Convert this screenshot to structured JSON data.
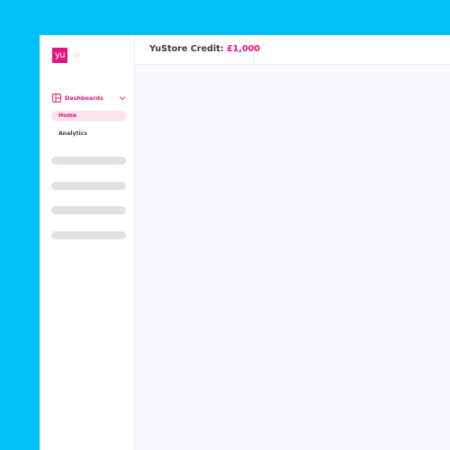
{
  "brand": {
    "logo_text": "yu",
    "accent_color": "#e5137e",
    "background_color": "#00c1f7"
  },
  "sidebar": {
    "group": {
      "icon": "dashboard-icon",
      "label": "Dashboards",
      "expanded": true,
      "chevron_icon": "chevron-down-icon"
    },
    "items": [
      {
        "label": "Home",
        "active": true
      },
      {
        "label": "Analytics",
        "active": false
      }
    ],
    "skeleton_count": 4
  },
  "topbar": {
    "credit_label": "YuStore Credit:",
    "credit_amount": "£1,000"
  }
}
